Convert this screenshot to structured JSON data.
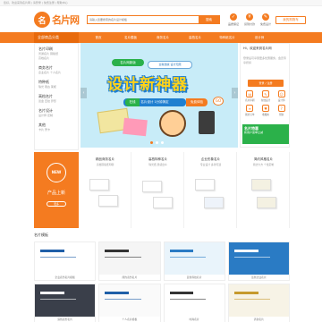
{
  "topstrip": {
    "text": "您好，欢迎来到名片网 | 请登录 | 免费注册 | 帮助中心"
  },
  "header": {
    "logo_mark": "名",
    "logo_text": "名片网",
    "search_placeholder": "请输入您要搜索的名片设计模板",
    "search_button": "搜索",
    "icons": [
      {
        "label": "品质保证",
        "glyph": "✓",
        "icon": "quality-icon"
      },
      {
        "label": "货到付款",
        "glyph": "¥",
        "icon": "payment-icon"
      },
      {
        "label": "免费设计",
        "glyph": "✎",
        "icon": "design-icon"
      }
    ],
    "cart": "我的购物车"
  },
  "nav": {
    "all": "全部商品分类",
    "items": [
      "首页",
      "名片模板",
      "商务名片",
      "高档名片",
      "特种纸名片",
      "设计师"
    ]
  },
  "sidebar": {
    "groups": [
      {
        "title": "名片印刷",
        "sub": [
          "普通名片 铜版纸",
          "高档名片"
        ]
      },
      {
        "title": "商务名片",
        "sub": [
          "企业名片 个人名片"
        ]
      },
      {
        "title": "特种纸",
        "sub": [
          "珠光 刚古 莱妮"
        ]
      },
      {
        "title": "高档名片",
        "sub": [
          "烫金 压纹 异形"
        ]
      },
      {
        "title": "名片设计",
        "sub": [
          "设计师 定制"
        ]
      },
      {
        "title": "其他",
        "sub": [
          "卡片 贺卡"
        ]
      }
    ]
  },
  "banner": {
    "tag": "名片网新版",
    "sub": "全新改版 设计无限",
    "title": "设计新神器",
    "pill_green": "在线",
    "pill": "名片设计 1分钟搞定",
    "pill_orange": "免费体验",
    "go": "GO",
    "prev": "‹",
    "next": "›",
    "slides": 3,
    "active_slide": 1
  },
  "right_panel": {
    "head": "Hi，欢迎来到名片网",
    "login_text": "登录后可享受更多优惠服务，会员专享折扣",
    "button": "登录 / 注册",
    "grid": [
      {
        "label": "名片印刷",
        "glyph": "▤"
      },
      {
        "label": "在线设计",
        "glyph": "✎"
      },
      {
        "label": "设计师",
        "glyph": "☺"
      },
      {
        "label": "我的订单",
        "glyph": "≡"
      },
      {
        "label": "收藏夹",
        "glyph": "♥"
      },
      {
        "label": "帮助",
        "glyph": "?"
      }
    ],
    "promo_title": "名片特惠",
    "promo_text": "新用户首单立减"
  },
  "new_section": {
    "badge": "NEW",
    "title": "产品上新",
    "more": "更多"
  },
  "products": [
    {
      "name": "精品商务名片",
      "desc": "高档铜版纸印刷"
    },
    {
      "name": "高档特种名片",
      "desc": "珠光纸 质感出众"
    },
    {
      "name": "企业形象名片",
      "desc": "专业设计 多款可选"
    },
    {
      "name": "简约风格名片",
      "desc": "简洁大方 个性定制"
    }
  ],
  "gallery_title": "名片模板",
  "gallery": [
    {
      "caption": "企业商务名片模板",
      "bg": "#ffffff",
      "accent": "#1f5fa8"
    },
    {
      "caption": "简约商务名片",
      "bg": "#f5f5f5",
      "accent": "#333333"
    },
    {
      "caption": "蓝色科技名片",
      "bg": "#e9f4fb",
      "accent": "#2a7bc4"
    },
    {
      "caption": "蓝色企业名片",
      "bg": "#2a7bc4",
      "accent": "#ffffff"
    },
    {
      "caption": "深色商务名片",
      "bg": "#3a3f4a",
      "accent": "#ffffff"
    },
    {
      "caption": "个人名片模板",
      "bg": "#fafafa",
      "accent": "#1f5fa8"
    },
    {
      "caption": "时尚名片",
      "bg": "#ffffff",
      "accent": "#333333"
    },
    {
      "caption": "清新名片",
      "bg": "#f7f3e6",
      "accent": "#c69a2e"
    }
  ],
  "colors": {
    "brand": "#f47b20",
    "brand_dark": "#e86a0c",
    "banner_bg": "#c8ecf8",
    "green": "#2bb14a",
    "blue": "#1f7fd0"
  }
}
